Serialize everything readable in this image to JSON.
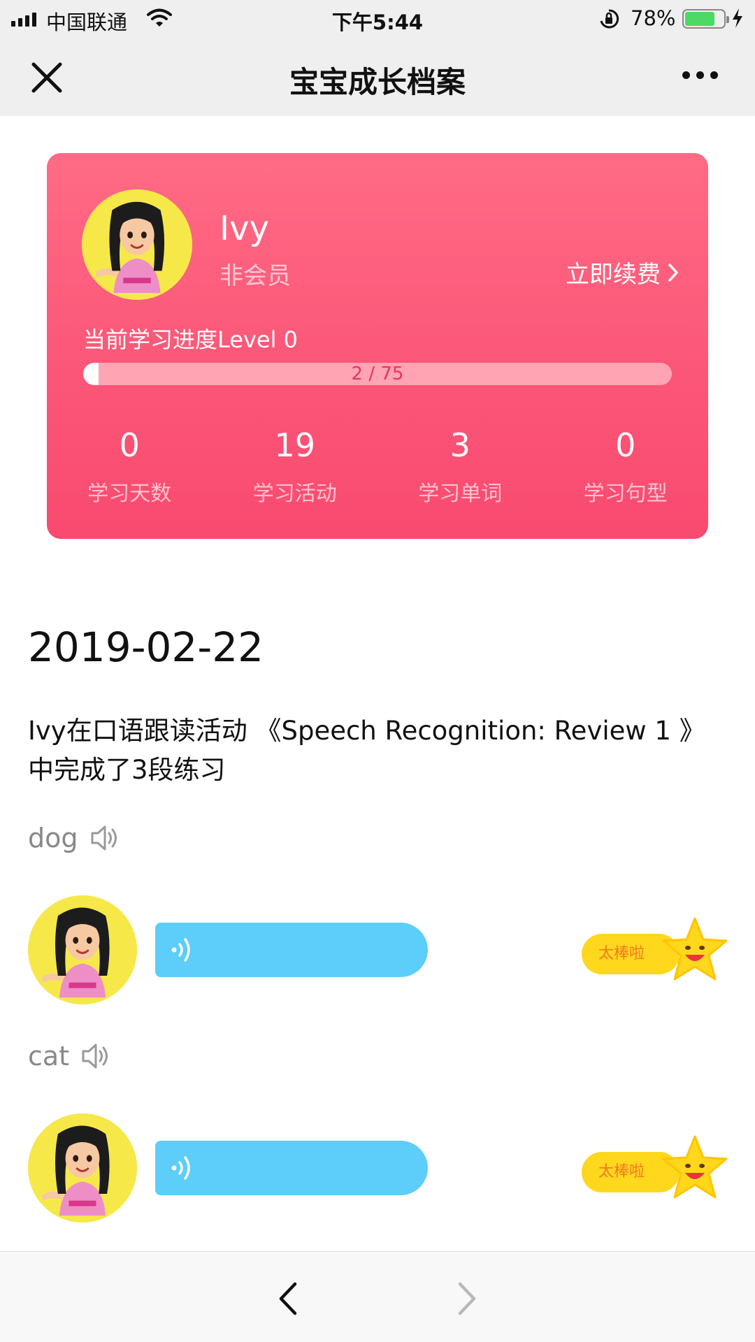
{
  "status_bar": {
    "carrier": "中国联通",
    "time": "下午5:44",
    "battery_percent": "78%",
    "battery_level": 0.78,
    "icons": [
      "signal-icon",
      "wifi-icon",
      "orientation-lock-icon",
      "battery-icon",
      "charging-icon"
    ]
  },
  "nav": {
    "title": "宝宝成长档案",
    "icons": [
      "close-icon",
      "more-icon"
    ]
  },
  "profile": {
    "name": "Ivy",
    "membership": "非会员",
    "renew_label": "立即续费",
    "progress_label": "当前学习进度Level 0",
    "progress_text": "2 / 75",
    "progress_value": 2,
    "progress_total": 75,
    "stats": [
      {
        "value": "0",
        "label": "学习天数"
      },
      {
        "value": "19",
        "label": "学习活动"
      },
      {
        "value": "3",
        "label": "学习单词"
      },
      {
        "value": "0",
        "label": "学习句型"
      }
    ],
    "accent_color": "#fb5577"
  },
  "feed": {
    "date": "2019-02-22",
    "activity_text": "Ivy在口语跟读活动 《Speech Recognition: Review 1 》中完成了3段练习",
    "items": [
      {
        "word": "dog",
        "praise": "太棒啦"
      },
      {
        "word": "cat",
        "praise": "太棒啦"
      }
    ],
    "voice_color": "#5dcdf9",
    "praise_color": "#ffd71c"
  },
  "bottom_bar": {
    "icons": [
      "back-arrow-icon",
      "forward-arrow-icon"
    ]
  }
}
